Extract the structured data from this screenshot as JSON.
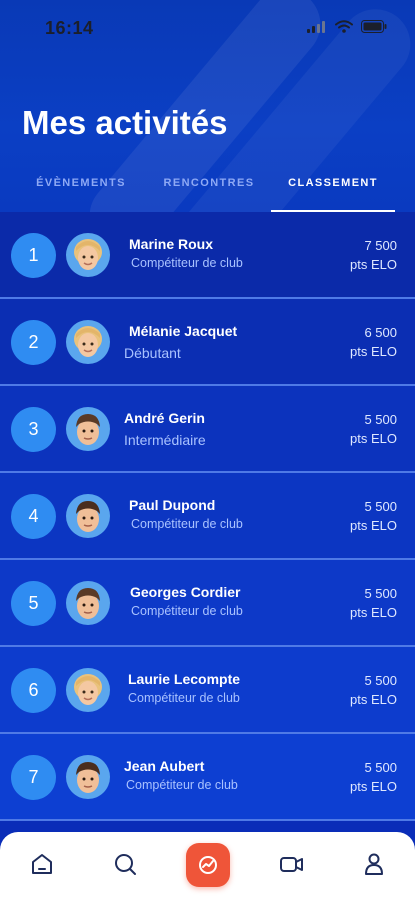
{
  "status_bar": {
    "time": "16:14"
  },
  "header": {
    "title": "Mes activités"
  },
  "tabs": [
    {
      "label": "ÉVÈNEMENTS",
      "active": false
    },
    {
      "label": "RENCONTRES",
      "active": false
    },
    {
      "label": "CLASSEMENT",
      "active": true
    }
  ],
  "ranking": [
    {
      "rank": "1",
      "name": "Marine Roux",
      "level": "Compétiteur de club",
      "points": "7 500",
      "unit": "pts ELO",
      "avatar": "female-avatar"
    },
    {
      "rank": "2",
      "name": "Mélanie Jacquet",
      "level": "Débutant",
      "points": "6 500",
      "unit": "pts ELO",
      "avatar": "female-avatar"
    },
    {
      "rank": "3",
      "name": "André Gerin",
      "level": "Intermédiaire",
      "points": "5 500",
      "unit": "pts ELO",
      "avatar": "male-avatar"
    },
    {
      "rank": "4",
      "name": "Paul Dupond",
      "level": "Compétiteur de club",
      "points": "5 500",
      "unit": "pts ELO",
      "avatar": "male-avatar"
    },
    {
      "rank": "5",
      "name": "Georges Cordier",
      "level": "Compétiteur de club",
      "points": "5 500",
      "unit": "pts ELO",
      "avatar": "male-avatar"
    },
    {
      "rank": "6",
      "name": "Laurie Lecompte",
      "level": "Compétiteur de club",
      "points": "5 500",
      "unit": "pts ELO",
      "avatar": "female-avatar"
    },
    {
      "rank": "7",
      "name": "Jean Aubert",
      "level": "Compétiteur de club",
      "points": "5 500",
      "unit": "pts ELO",
      "avatar": "male-avatar"
    }
  ],
  "bottom_nav": [
    {
      "icon": "home-icon"
    },
    {
      "icon": "search-icon"
    },
    {
      "icon": "activity-icon",
      "active": true
    },
    {
      "icon": "video-icon"
    },
    {
      "icon": "profile-icon"
    }
  ],
  "colors": {
    "accent": "#ef5539",
    "rank_badge": "#2f8cf2",
    "background": "#0a2db8"
  }
}
